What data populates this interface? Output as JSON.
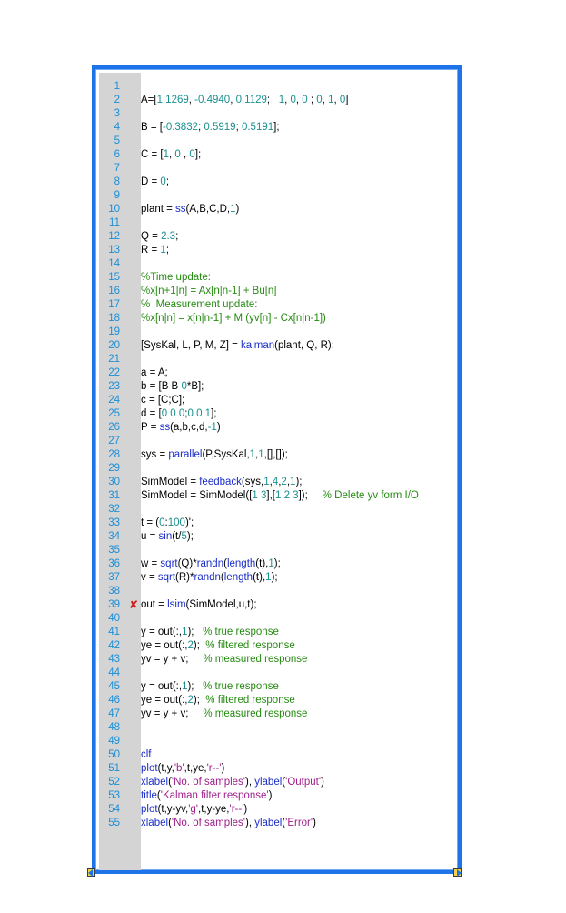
{
  "editor": {
    "error_line": 39,
    "error_marker": "✘",
    "colors": {
      "frame": "#1e73e8",
      "gutter": "#d4d4d4",
      "line_number": "#1a8fd8",
      "number": "#1a8f8f",
      "function": "#1b2dc8",
      "string": "#a0208c",
      "comment": "#268b12",
      "error": "#d01818"
    },
    "lines": [
      {
        "n": "1",
        "tokens": []
      },
      {
        "n": "2",
        "tokens": [
          [
            "p",
            "A=["
          ],
          [
            "n",
            "1.1269"
          ],
          [
            "p",
            ", "
          ],
          [
            "n",
            "-0.4940"
          ],
          [
            "p",
            ", "
          ],
          [
            "n",
            "0.1129"
          ],
          [
            "p",
            ";   "
          ],
          [
            "n",
            "1"
          ],
          [
            "p",
            ", "
          ],
          [
            "n",
            "0"
          ],
          [
            "p",
            ", "
          ],
          [
            "n",
            "0"
          ],
          [
            "p",
            " ; "
          ],
          [
            "n",
            "0"
          ],
          [
            "p",
            ", "
          ],
          [
            "n",
            "1"
          ],
          [
            "p",
            ", "
          ],
          [
            "n",
            "0"
          ],
          [
            "p",
            "]"
          ]
        ]
      },
      {
        "n": "3",
        "tokens": []
      },
      {
        "n": "4",
        "tokens": [
          [
            "p",
            "B = ["
          ],
          [
            "n",
            "-0.3832"
          ],
          [
            "p",
            "; "
          ],
          [
            "n",
            "0.5919"
          ],
          [
            "p",
            "; "
          ],
          [
            "n",
            "0.5191"
          ],
          [
            "p",
            "];"
          ]
        ]
      },
      {
        "n": "5",
        "tokens": []
      },
      {
        "n": "6",
        "tokens": [
          [
            "p",
            "C = ["
          ],
          [
            "n",
            "1"
          ],
          [
            "p",
            ", "
          ],
          [
            "n",
            "0"
          ],
          [
            "p",
            " , "
          ],
          [
            "n",
            "0"
          ],
          [
            "p",
            "];"
          ]
        ]
      },
      {
        "n": "7",
        "tokens": []
      },
      {
        "n": "8",
        "tokens": [
          [
            "p",
            "D = "
          ],
          [
            "n",
            "0"
          ],
          [
            "p",
            ";"
          ]
        ]
      },
      {
        "n": "9",
        "tokens": []
      },
      {
        "n": "10",
        "tokens": [
          [
            "p",
            "plant = "
          ],
          [
            "f",
            "ss"
          ],
          [
            "p",
            "(A,B,C,D,"
          ],
          [
            "n",
            "1"
          ],
          [
            "p",
            ")"
          ]
        ]
      },
      {
        "n": "11",
        "tokens": []
      },
      {
        "n": "12",
        "tokens": [
          [
            "p",
            "Q = "
          ],
          [
            "n",
            "2.3"
          ],
          [
            "p",
            ";"
          ]
        ]
      },
      {
        "n": "13",
        "tokens": [
          [
            "p",
            "R = "
          ],
          [
            "n",
            "1"
          ],
          [
            "p",
            ";"
          ]
        ]
      },
      {
        "n": "14",
        "tokens": []
      },
      {
        "n": "15",
        "tokens": [
          [
            "c",
            "%Time update:"
          ]
        ]
      },
      {
        "n": "16",
        "tokens": [
          [
            "c",
            "%x[n+1|n] = Ax[n|n-1] + Bu[n]"
          ]
        ]
      },
      {
        "n": "17",
        "tokens": [
          [
            "c",
            "%  Measurement update:"
          ]
        ]
      },
      {
        "n": "18",
        "tokens": [
          [
            "c",
            "%x[n|n] = x[n|n-1] + M (yv[n] - Cx[n|n-1])"
          ]
        ]
      },
      {
        "n": "19",
        "tokens": []
      },
      {
        "n": "20",
        "tokens": [
          [
            "p",
            "[SysKal, L, P, M, Z] = "
          ],
          [
            "f",
            "kalman"
          ],
          [
            "p",
            "(plant, Q, R);"
          ]
        ]
      },
      {
        "n": "21",
        "tokens": []
      },
      {
        "n": "22",
        "tokens": [
          [
            "p",
            "a = A;"
          ]
        ]
      },
      {
        "n": "23",
        "tokens": [
          [
            "p",
            "b = [B B "
          ],
          [
            "n",
            "0"
          ],
          [
            "p",
            "*B];"
          ]
        ]
      },
      {
        "n": "24",
        "tokens": [
          [
            "p",
            "c = [C;C];"
          ]
        ]
      },
      {
        "n": "25",
        "tokens": [
          [
            "p",
            "d = ["
          ],
          [
            "n",
            "0 0 0"
          ],
          [
            "p",
            ";"
          ],
          [
            "n",
            "0 0 1"
          ],
          [
            "p",
            "];"
          ]
        ]
      },
      {
        "n": "26",
        "tokens": [
          [
            "p",
            "P = "
          ],
          [
            "f",
            "ss"
          ],
          [
            "p",
            "(a,b,c,d,"
          ],
          [
            "n",
            "-1"
          ],
          [
            "p",
            ")"
          ]
        ]
      },
      {
        "n": "27",
        "tokens": []
      },
      {
        "n": "28",
        "tokens": [
          [
            "p",
            "sys = "
          ],
          [
            "f",
            "parallel"
          ],
          [
            "p",
            "(P,SysKal,"
          ],
          [
            "n",
            "1"
          ],
          [
            "p",
            ","
          ],
          [
            "n",
            "1"
          ],
          [
            "p",
            ",[],[]);"
          ]
        ]
      },
      {
        "n": "29",
        "tokens": []
      },
      {
        "n": "30",
        "tokens": [
          [
            "p",
            "SimModel = "
          ],
          [
            "f",
            "feedback"
          ],
          [
            "p",
            "(sys,"
          ],
          [
            "n",
            "1"
          ],
          [
            "p",
            ","
          ],
          [
            "n",
            "4"
          ],
          [
            "p",
            ","
          ],
          [
            "n",
            "2"
          ],
          [
            "p",
            ","
          ],
          [
            "n",
            "1"
          ],
          [
            "p",
            ");"
          ]
        ]
      },
      {
        "n": "31",
        "tokens": [
          [
            "p",
            "SimModel = SimModel(["
          ],
          [
            "n",
            "1 3"
          ],
          [
            "p",
            "],["
          ],
          [
            "n",
            "1 2 3"
          ],
          [
            "p",
            "]);     "
          ],
          [
            "c",
            "% Delete yv form I/O"
          ]
        ]
      },
      {
        "n": "32",
        "tokens": []
      },
      {
        "n": "33",
        "tokens": [
          [
            "p",
            "t = ("
          ],
          [
            "n",
            "0"
          ],
          [
            "p",
            ":"
          ],
          [
            "n",
            "100"
          ],
          [
            "p",
            ")';"
          ]
        ]
      },
      {
        "n": "34",
        "tokens": [
          [
            "p",
            "u = "
          ],
          [
            "f",
            "sin"
          ],
          [
            "p",
            "(t/"
          ],
          [
            "n",
            "5"
          ],
          [
            "p",
            ");"
          ]
        ]
      },
      {
        "n": "35",
        "tokens": []
      },
      {
        "n": "36",
        "tokens": [
          [
            "p",
            "w = "
          ],
          [
            "f",
            "sqrt"
          ],
          [
            "p",
            "(Q)*"
          ],
          [
            "f",
            "randn"
          ],
          [
            "p",
            "("
          ],
          [
            "f",
            "length"
          ],
          [
            "p",
            "(t),"
          ],
          [
            "n",
            "1"
          ],
          [
            "p",
            ");"
          ]
        ]
      },
      {
        "n": "37",
        "tokens": [
          [
            "p",
            "v = "
          ],
          [
            "f",
            "sqrt"
          ],
          [
            "p",
            "(R)*"
          ],
          [
            "f",
            "randn"
          ],
          [
            "p",
            "("
          ],
          [
            "f",
            "length"
          ],
          [
            "p",
            "(t),"
          ],
          [
            "n",
            "1"
          ],
          [
            "p",
            ");"
          ]
        ]
      },
      {
        "n": "38",
        "tokens": []
      },
      {
        "n": "39",
        "tokens": [
          [
            "p",
            "out = "
          ],
          [
            "f",
            "lsim"
          ],
          [
            "p",
            "(SimModel,u,t);"
          ]
        ]
      },
      {
        "n": "40",
        "tokens": []
      },
      {
        "n": "41",
        "tokens": [
          [
            "p",
            "y = out(:,"
          ],
          [
            "n",
            "1"
          ],
          [
            "p",
            ");   "
          ],
          [
            "c",
            "% true response"
          ]
        ]
      },
      {
        "n": "42",
        "tokens": [
          [
            "p",
            "ye = out(:,"
          ],
          [
            "n",
            "2"
          ],
          [
            "p",
            ");  "
          ],
          [
            "c",
            "% filtered response"
          ]
        ]
      },
      {
        "n": "43",
        "tokens": [
          [
            "p",
            "yv = y + v;     "
          ],
          [
            "c",
            "% measured response"
          ]
        ]
      },
      {
        "n": "44",
        "tokens": []
      },
      {
        "n": "45",
        "tokens": [
          [
            "p",
            "y = out(:,"
          ],
          [
            "n",
            "1"
          ],
          [
            "p",
            ");   "
          ],
          [
            "c",
            "% true response"
          ]
        ]
      },
      {
        "n": "46",
        "tokens": [
          [
            "p",
            "ye = out(:,"
          ],
          [
            "n",
            "2"
          ],
          [
            "p",
            ");  "
          ],
          [
            "c",
            "% filtered response"
          ]
        ]
      },
      {
        "n": "47",
        "tokens": [
          [
            "p",
            "yv = y + v;     "
          ],
          [
            "c",
            "% measured response"
          ]
        ]
      },
      {
        "n": "48",
        "tokens": []
      },
      {
        "n": "49",
        "tokens": []
      },
      {
        "n": "50",
        "tokens": [
          [
            "f",
            "clf"
          ]
        ]
      },
      {
        "n": "51",
        "tokens": [
          [
            "f",
            "plot"
          ],
          [
            "p",
            "(t,y,"
          ],
          [
            "s",
            "'b'"
          ],
          [
            "p",
            ",t,ye,"
          ],
          [
            "s",
            "'r--'"
          ],
          [
            "p",
            ")"
          ]
        ]
      },
      {
        "n": "52",
        "tokens": [
          [
            "f",
            "xlabel"
          ],
          [
            "p",
            "("
          ],
          [
            "s",
            "'No. of samples'"
          ],
          [
            "p",
            "), "
          ],
          [
            "f",
            "ylabel"
          ],
          [
            "p",
            "("
          ],
          [
            "s",
            "'Output'"
          ],
          [
            "p",
            ")"
          ]
        ]
      },
      {
        "n": "53",
        "tokens": [
          [
            "f",
            "title"
          ],
          [
            "p",
            "("
          ],
          [
            "s",
            "'Kalman filter response'"
          ],
          [
            "p",
            ")"
          ]
        ]
      },
      {
        "n": "54",
        "tokens": [
          [
            "f",
            "plot"
          ],
          [
            "p",
            "(t,y-yv,"
          ],
          [
            "s",
            "'g'"
          ],
          [
            "p",
            ",t,y-ye,"
          ],
          [
            "s",
            "'r--'"
          ],
          [
            "p",
            ")"
          ]
        ]
      },
      {
        "n": "55",
        "tokens": [
          [
            "f",
            "xlabel"
          ],
          [
            "p",
            "("
          ],
          [
            "s",
            "'No. of samples'"
          ],
          [
            "p",
            "), "
          ],
          [
            "f",
            "ylabel"
          ],
          [
            "p",
            "("
          ],
          [
            "s",
            "'Error'"
          ],
          [
            "p",
            ")"
          ]
        ]
      }
    ]
  }
}
